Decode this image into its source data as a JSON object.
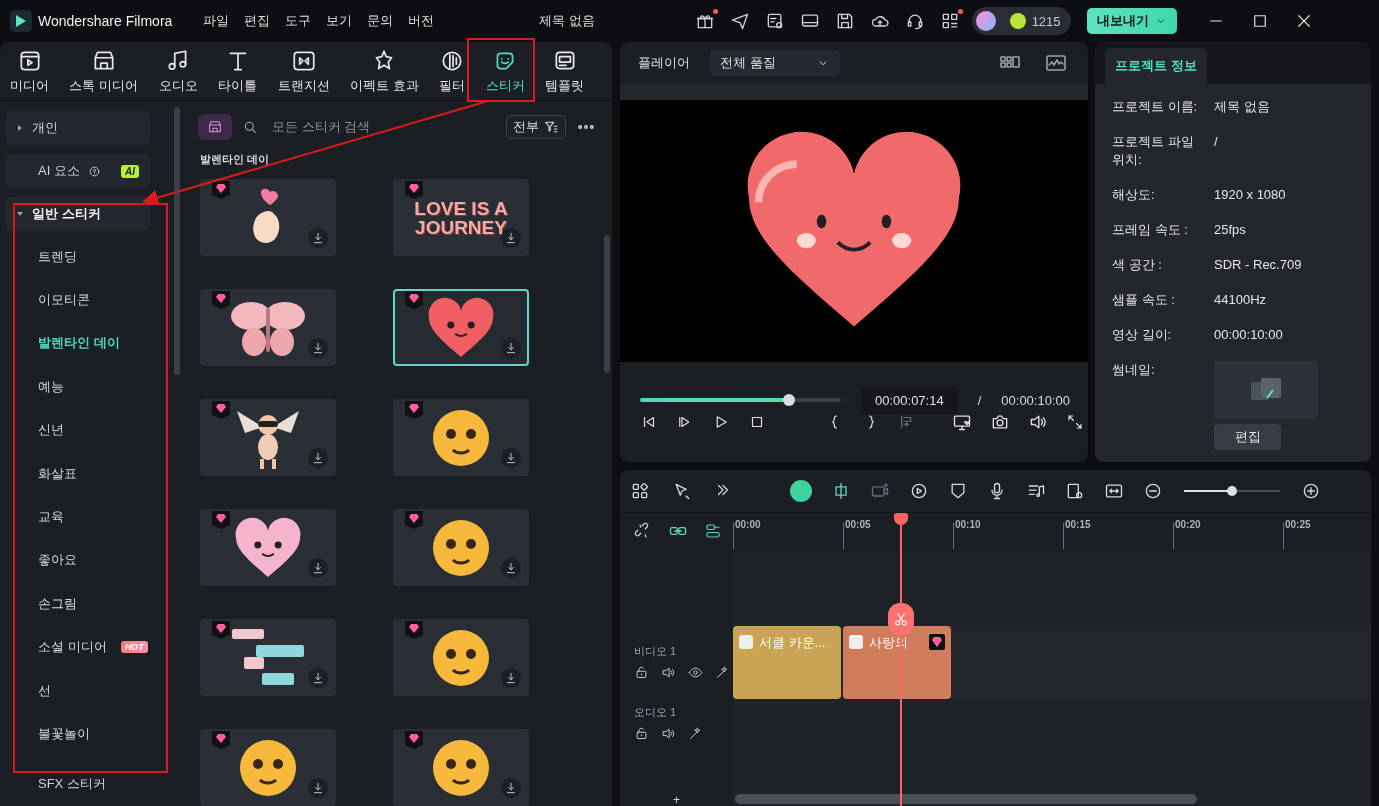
{
  "app": {
    "name": "Wondershare Filmora",
    "menus": [
      "파일",
      "편집",
      "도구",
      "보기",
      "문의",
      "버전"
    ],
    "title": "제목 없음",
    "credits": "1215",
    "export_button": "내보내기"
  },
  "media_tabs": [
    {
      "label": "미디어",
      "selected": false
    },
    {
      "label": "스톡 미디어",
      "selected": false
    },
    {
      "label": "오디오",
      "selected": false
    },
    {
      "label": "타이틀",
      "selected": false
    },
    {
      "label": "트랜지션",
      "selected": false
    },
    {
      "label": "이펙트 효과",
      "selected": false
    },
    {
      "label": "필터",
      "selected": false
    },
    {
      "label": "스티커",
      "selected": true
    },
    {
      "label": "템플릿",
      "selected": false
    }
  ],
  "sidebar": {
    "items": [
      {
        "kind": "group",
        "label": "개인",
        "expanded": false
      },
      {
        "kind": "ai",
        "label": "AI 요소",
        "badge": "AI"
      },
      {
        "kind": "group",
        "label": "일반 스티커",
        "expanded": true,
        "children": [
          {
            "label": "트렌딩",
            "selected": false
          },
          {
            "label": "이모티콘",
            "selected": false
          },
          {
            "label": "발렌타인 데이",
            "selected": true
          },
          {
            "label": "예능",
            "selected": false
          },
          {
            "label": "신년",
            "selected": false
          },
          {
            "label": "화살표",
            "selected": false
          },
          {
            "label": "교육",
            "selected": false
          },
          {
            "label": "좋아요",
            "selected": false
          },
          {
            "label": "손그림",
            "selected": false
          },
          {
            "label": "소셜 미디어",
            "badge": "HOT",
            "selected": false
          },
          {
            "label": "선",
            "selected": false
          },
          {
            "label": "불꽃놀이",
            "selected": false
          }
        ]
      },
      {
        "kind": "plain",
        "label": "SFX 스티커"
      }
    ]
  },
  "sticker_browser": {
    "search_placeholder": "모든 스티커 검색",
    "filter": "전부",
    "section_title": "발렌타인 데이",
    "stickers": [
      {
        "kind": "hand-heart",
        "selected": false
      },
      {
        "kind": "text",
        "caption": "LOVE IS A JOURNEY",
        "selected": false
      },
      {
        "kind": "butterfly",
        "selected": false
      },
      {
        "kind": "red-heart",
        "selected": true
      },
      {
        "kind": "cupid",
        "selected": false
      },
      {
        "kind": "emoji",
        "selected": false
      },
      {
        "kind": "pink-heart",
        "selected": false
      },
      {
        "kind": "emoji",
        "selected": false
      },
      {
        "kind": "chat",
        "selected": false
      },
      {
        "kind": "emoji",
        "selected": false
      },
      {
        "kind": "emoji",
        "selected": false
      },
      {
        "kind": "emoji",
        "selected": false
      }
    ]
  },
  "player": {
    "label": "플레이어",
    "quality": "전체 품질",
    "level": 0.74,
    "current_time": "00:00:07:14",
    "separator": "/",
    "total_time": "00:00:10:00"
  },
  "project_info": {
    "tab": "프로젝트 정보",
    "rows": [
      {
        "label": "프로젝트 이름:",
        "value": "제목 없음"
      },
      {
        "label": "프로젝트 파일 위치:",
        "value": "/"
      },
      {
        "label": "해상도:",
        "value": "1920 x 1080"
      },
      {
        "label": "프레임 속도 :",
        "value": "25fps"
      },
      {
        "label": "색 공간 :",
        "value": "SDR - Rec.709"
      },
      {
        "label": "샘플 속도 :",
        "value": "44100Hz"
      },
      {
        "label": "영상 길이:",
        "value": "00:00:10:00"
      }
    ],
    "thumbnail_label": "썸네일:",
    "edit_button": "편집"
  },
  "timeline": {
    "zoom": {
      "level": 0.5
    },
    "ruler": [
      "00:00",
      "00:05",
      "00:10",
      "00:15",
      "00:20",
      "00:25"
    ],
    "playhead": {
      "level": 0.264
    },
    "tracks": [
      {
        "kind": "video",
        "name": "비디오 1",
        "clips": [
          {
            "title": "서클 카운...",
            "color": "#c9a455"
          },
          {
            "title": "사랑의",
            "color": "#d07d5c"
          }
        ]
      },
      {
        "kind": "audio",
        "name": "오디오 1"
      }
    ],
    "add_track": "+"
  }
}
